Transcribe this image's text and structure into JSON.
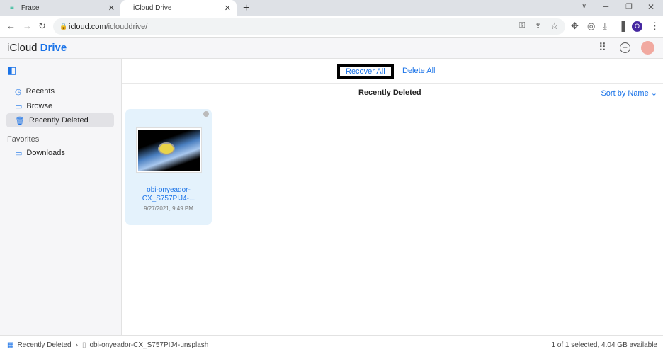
{
  "browser": {
    "tabs": [
      {
        "title": "Frase",
        "active": false
      },
      {
        "title": "iCloud Drive",
        "active": true
      }
    ],
    "url_domain": "icloud.com",
    "url_path": "/iclouddrive/",
    "profile_initial": "O"
  },
  "app": {
    "logo_text": "iCloud",
    "logo_accent": "Drive",
    "accent": "#1a73e8"
  },
  "sidebar": {
    "items": [
      {
        "label": "Recents",
        "icon": "clock-icon"
      },
      {
        "label": "Browse",
        "icon": "folder-icon"
      },
      {
        "label": "Recently Deleted",
        "icon": "trash-icon",
        "selected": true
      }
    ],
    "favorites_heading": "Favorites",
    "favorites": [
      {
        "label": "Downloads",
        "icon": "folder-icon"
      }
    ]
  },
  "toolbar": {
    "recover_all": "Recover All",
    "delete_all": "Delete All"
  },
  "view": {
    "title": "Recently Deleted",
    "sort_label": "Sort by Name"
  },
  "files": [
    {
      "name_line1": "obi-onyeador-",
      "name_line2": "CX_S757PIJ4-...",
      "date": "9/27/2021, 9:49 PM"
    }
  ],
  "footer": {
    "path_root": "Recently Deleted",
    "path_file": "obi-onyeador-CX_S757PIJ4-unsplash",
    "status": "1 of 1 selected, 4.04 GB available"
  }
}
